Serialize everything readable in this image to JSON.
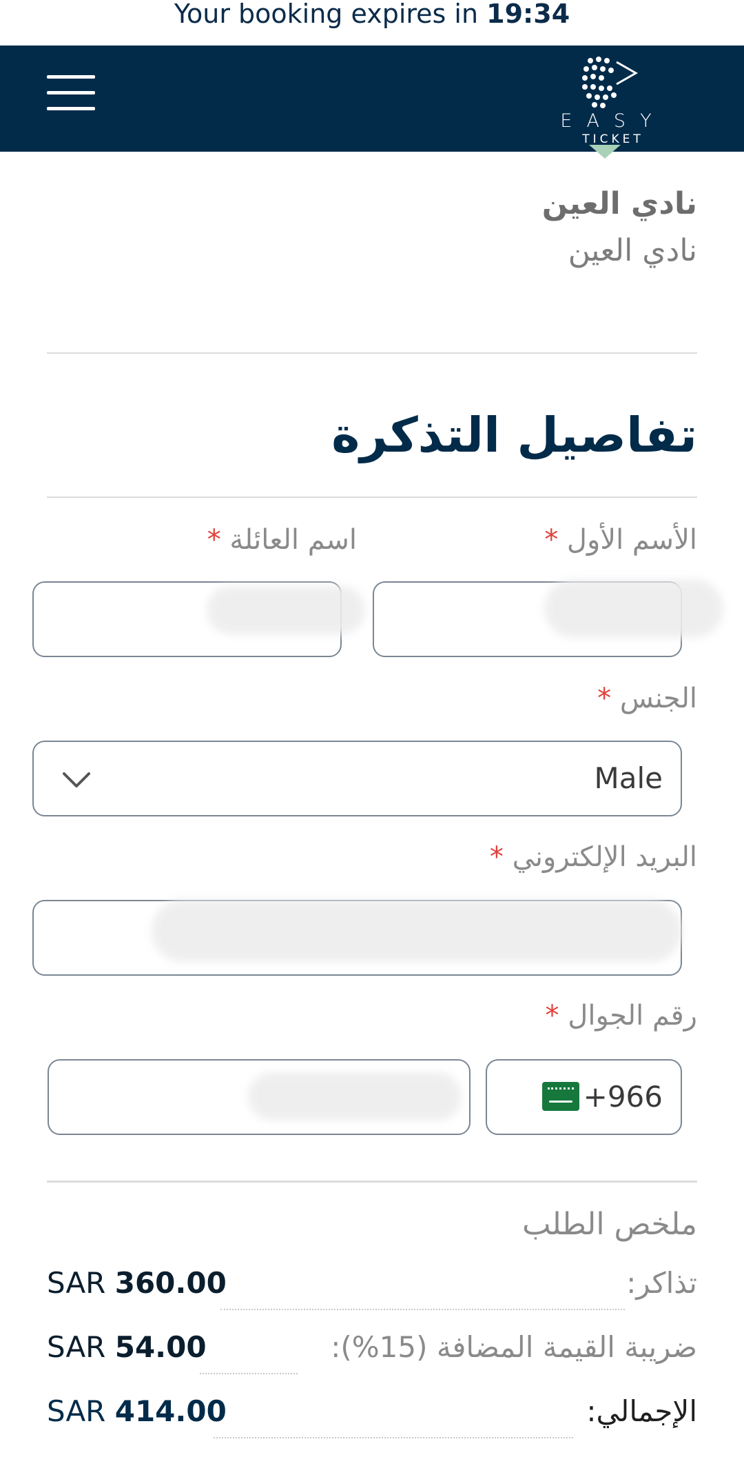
{
  "timer": {
    "prefix": "Your booking expires in",
    "time": "19:34"
  },
  "header": {
    "menu_icon": "hamburger-icon",
    "logo_word": "EASY",
    "logo_sub": "TICKET"
  },
  "club": {
    "name": "نادي العين",
    "subtitle": "نادي العين"
  },
  "ticket_details": {
    "title": "تفاصيل التذكرة",
    "first_name_label": "الأسم الأول",
    "last_name_label": "اسم العائلة",
    "required_mark": "*",
    "gender_label": "الجنس",
    "gender_value": "Male",
    "email_label": "البريد الإلكتروني",
    "mobile_label": "رقم الجوال",
    "country_code": "+966",
    "country_flag": "saudi-arabia-flag-icon"
  },
  "order_summary": {
    "title": "ملخص الطلب",
    "rows": [
      {
        "label": "تذاكر:",
        "currency": "SAR",
        "amount": "360.00"
      },
      {
        "label": "ضريبة القيمة المضافة (15%):",
        "currency": "SAR",
        "amount": "54.00"
      },
      {
        "label": "الإجمالي:",
        "currency": "SAR",
        "amount": "414.00"
      }
    ]
  },
  "colors": {
    "navy": "#022b4a",
    "required": "#e0413b",
    "label_gray": "#8a8a8a",
    "flag_green": "#16783d"
  }
}
